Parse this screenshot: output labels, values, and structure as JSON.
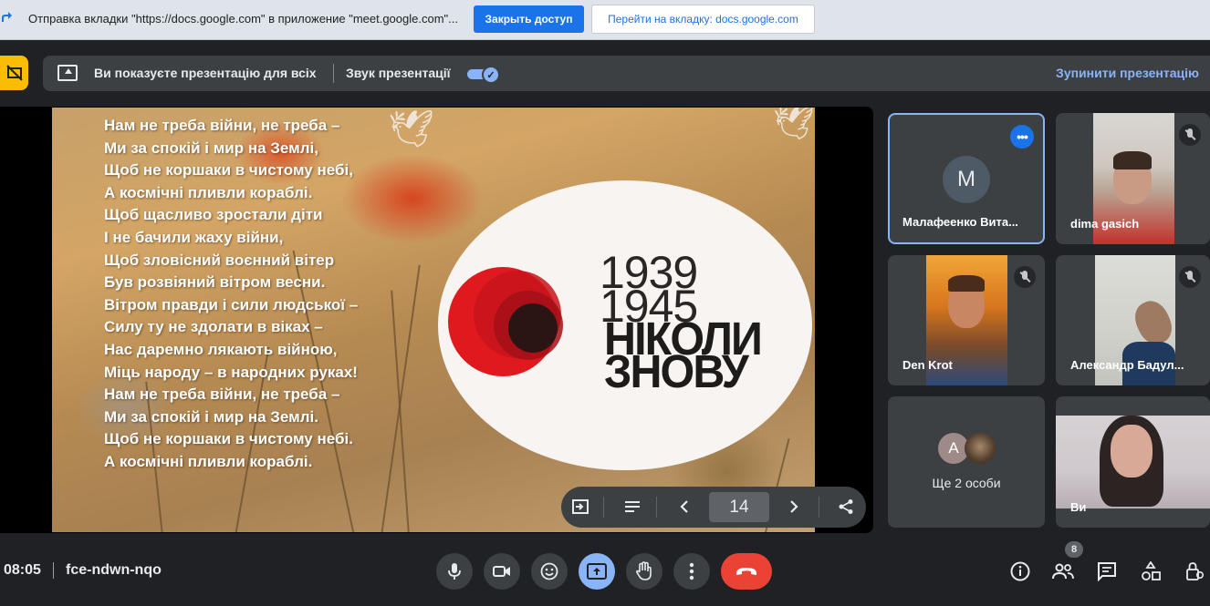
{
  "share_bar": {
    "message": "Отправка вкладки \"https://docs.google.com\" в приложение \"meet.google.com\"...",
    "close_access_label": "Закрыть доступ",
    "goto_tab_label": "Перейти на вкладку: docs.google.com"
  },
  "presenting": {
    "status_text": "Ви показуєте презентацію для всіх",
    "audio_label": "Звук презентації",
    "audio_enabled": true,
    "stop_label": "Зупинити презентацію"
  },
  "slide": {
    "poem_lines": [
      "Нам не треба війни, не треба –",
      "Ми за спокій і мир на Землі,",
      "Щоб не коршаки в чистому небі,",
      "А космічні пливли кораблі.",
      "Щоб щасливо зростали діти",
      "І не бачили жаху війни,",
      "Щоб зловісний воєнний вітер",
      "Був розвіяний вітром весни.",
      "Вітром правди і сили людської –",
      "Силу ту не здолати в віках –",
      "Нас даремно лякають війною,",
      "Міць народу – в народних руках!",
      "Нам не треба війни, не треба –",
      "Ми за спокій і мир на Землі.",
      "Щоб не коршаки в чистому небі.",
      "А космічні пливли кораблі."
    ],
    "year_start": "1939",
    "year_end": "1945",
    "slogan_line1": "НІКОЛИ",
    "slogan_line2": "ЗНОВУ"
  },
  "slide_controls": {
    "page_number": "14"
  },
  "participants": [
    {
      "name": "Малафеенко Вита...",
      "avatar_letter": "M",
      "type": "avatar",
      "active": true
    },
    {
      "name": "dima gasich",
      "type": "video",
      "muted": true
    },
    {
      "name": "Den Krot",
      "type": "video",
      "muted": true
    },
    {
      "name": "Александр Бадул...",
      "type": "video",
      "muted": true
    },
    {
      "name": "Ще 2 особи",
      "type": "group",
      "avatar_letter": "A"
    },
    {
      "name": "Ви",
      "type": "video"
    }
  ],
  "meeting": {
    "time": "08:05",
    "code": "fce-ndwn-nqo",
    "participant_count": "8"
  },
  "colors": {
    "accent": "#8ab4f8",
    "primary_button": "#1a73e8",
    "end_call": "#ea4335",
    "warning": "#fbbc04"
  }
}
